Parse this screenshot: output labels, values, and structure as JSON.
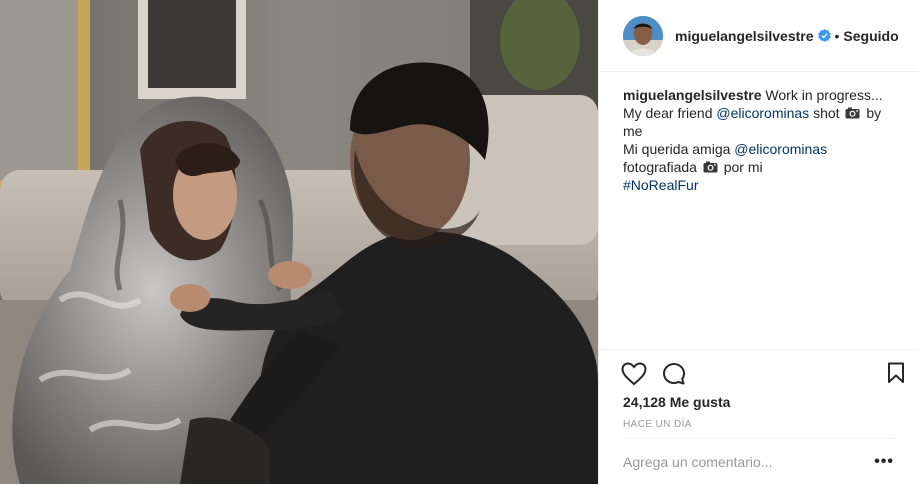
{
  "header": {
    "username": "miguelangelsilvestre",
    "separator": "•",
    "follow_status": "Seguido"
  },
  "caption": {
    "username": "miguelangelsilvestre",
    "line1": "Work in progress...",
    "line2_prefix": "My dear friend ",
    "mention1": "@elicorominas",
    "line2_mid": " shot ",
    "line2_suffix": " by me",
    "line3_prefix": "Mi querida amiga ",
    "mention2": "@elicorominas",
    "line4_prefix": "fotografiada ",
    "line4_suffix": " por mi",
    "hashtag": "#NoRealFur"
  },
  "stats": {
    "likes": "24,128 Me gusta",
    "time": "HACE UN DÍA"
  },
  "comment": {
    "placeholder": "Agrega un comentario...",
    "more": "•••"
  },
  "icons": {
    "like": "heart-icon",
    "comment": "comment-icon",
    "save": "bookmark-icon",
    "verified": "verified-badge-icon",
    "camera": "camera-emoji-icon"
  }
}
